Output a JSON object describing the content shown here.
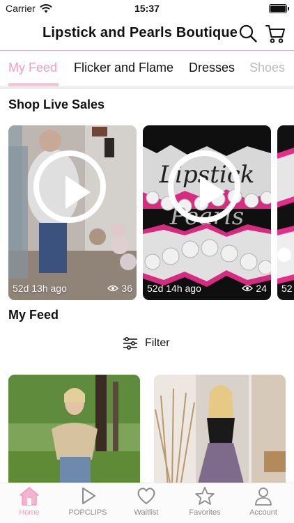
{
  "status": {
    "carrier": "Carrier",
    "time": "15:37"
  },
  "header": {
    "title": "Lipstick and Pearls Boutique"
  },
  "tabs": [
    {
      "label": "My Feed",
      "active": true
    },
    {
      "label": "Flicker and Flame"
    },
    {
      "label": "Dresses"
    },
    {
      "label": "Shoes"
    }
  ],
  "live": {
    "title": "Shop Live Sales",
    "videos": [
      {
        "time": "52d 13h ago",
        "views": "36"
      },
      {
        "time": "52d 14h ago",
        "views": "24"
      },
      {
        "time": "52"
      }
    ]
  },
  "feed": {
    "title": "My Feed",
    "filter_label": "Filter"
  },
  "nav": [
    {
      "label": "Home",
      "icon": "home-icon",
      "active": true
    },
    {
      "label": "POPCLIPS",
      "icon": "play-icon"
    },
    {
      "label": "Waitlist",
      "icon": "heart-icon"
    },
    {
      "label": "Favorites",
      "icon": "star-icon"
    },
    {
      "label": "Account",
      "icon": "person-icon"
    }
  ],
  "colors": {
    "accent": "#f19cc1",
    "header_line": "#e8b3c4"
  }
}
